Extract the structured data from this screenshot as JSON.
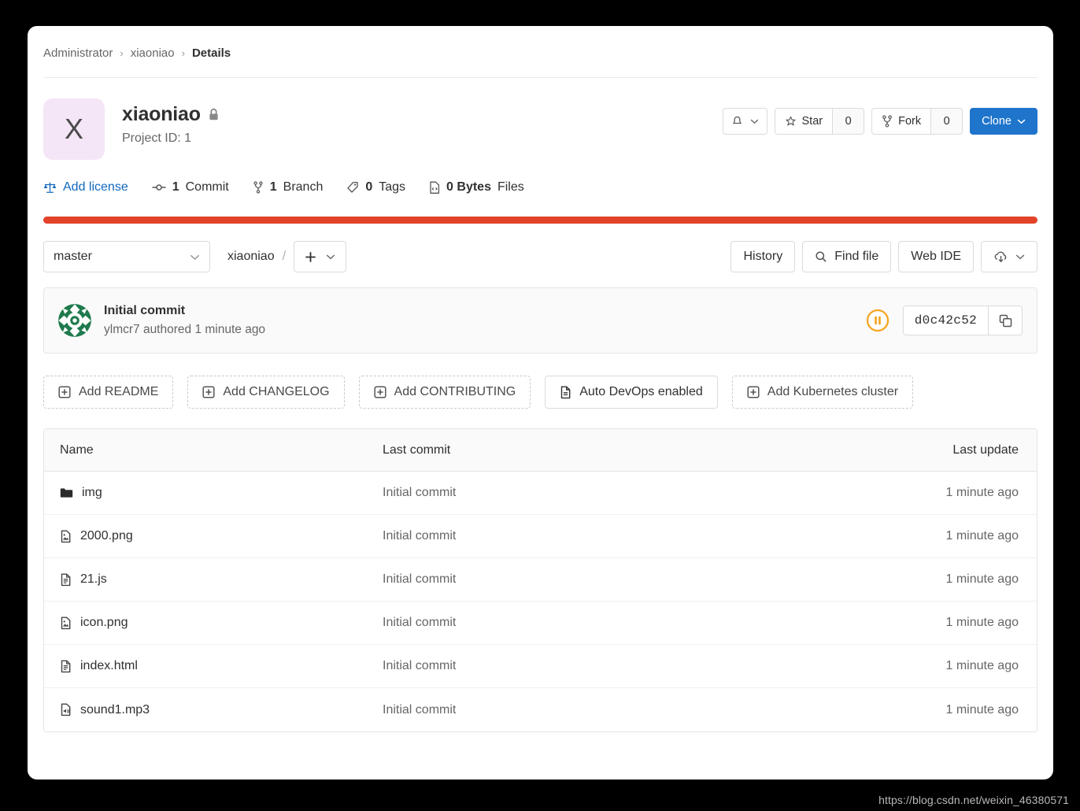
{
  "breadcrumb": {
    "items": [
      {
        "label": "Administrator",
        "current": false
      },
      {
        "label": "xiaoniao",
        "current": false
      },
      {
        "label": "Details",
        "current": true
      }
    ],
    "separator": "›"
  },
  "project": {
    "avatar_letter": "X",
    "avatar_bg": "#f4e6f6",
    "name": "xiaoniao",
    "visibility_icon": "lock-icon",
    "id_label": "Project ID: 1"
  },
  "header_actions": {
    "notifications_icon": "bell-icon",
    "notifications_chevron": "chevron-down-icon",
    "star_label": "Star",
    "star_count": "0",
    "star_icon": "star-icon",
    "fork_label": "Fork",
    "fork_count": "0",
    "fork_icon": "fork-icon",
    "clone_label": "Clone",
    "clone_chevron": "chevron-down-icon",
    "clone_color": "#1f75cb"
  },
  "stats": [
    {
      "icon": "scale-icon",
      "value": "",
      "label": "Add license",
      "link": true
    },
    {
      "icon": "commit-icon",
      "value": "1",
      "label": "Commit",
      "link": false
    },
    {
      "icon": "branch-icon",
      "value": "1",
      "label": "Branch",
      "link": false
    },
    {
      "icon": "tag-icon",
      "value": "0",
      "label": "Tags",
      "link": false
    },
    {
      "icon": "file-code-icon",
      "value": "0 Bytes",
      "label": "Files",
      "link": false
    }
  ],
  "language_bar": {
    "color": "#e24329"
  },
  "toolbar": {
    "branch": "master",
    "branch_chevron": "chevron-down-icon",
    "path_name": "xiaoniao",
    "path_separator": "/",
    "add_icon": "plus-icon",
    "add_chevron": "chevron-down-icon",
    "history_label": "History",
    "find_file_label": "Find file",
    "find_file_icon": "search-icon",
    "web_ide_label": "Web IDE",
    "download_icon": "download-cloud-icon",
    "download_chevron": "chevron-down-icon"
  },
  "commit": {
    "avatar": "identicon-green",
    "title": "Initial commit",
    "subtitle": "ylmcr7 authored 1 minute ago",
    "pipeline_status_icon": "pipeline-pending-icon",
    "pipeline_status_color": "#f5a623",
    "sha": "d0c42c52",
    "copy_icon": "copy-icon"
  },
  "add_file_buttons": [
    {
      "icon": "plus-square-icon",
      "label": "Add README",
      "dashed": true
    },
    {
      "icon": "plus-square-icon",
      "label": "Add CHANGELOG",
      "dashed": true
    },
    {
      "icon": "plus-square-icon",
      "label": "Add CONTRIBUTING",
      "dashed": true
    },
    {
      "icon": "doc-icon",
      "label": "Auto DevOps enabled",
      "dashed": false
    },
    {
      "icon": "plus-square-icon",
      "label": "Add Kubernetes cluster",
      "dashed": true
    }
  ],
  "file_table": {
    "columns": {
      "name": "Name",
      "last_commit": "Last commit",
      "last_update": "Last update"
    },
    "rows": [
      {
        "icon": "folder-icon",
        "name": "img",
        "last_commit": "Initial commit",
        "last_update": "1 minute ago"
      },
      {
        "icon": "image-file-icon",
        "name": "2000.png",
        "last_commit": "Initial commit",
        "last_update": "1 minute ago"
      },
      {
        "icon": "text-file-icon",
        "name": "21.js",
        "last_commit": "Initial commit",
        "last_update": "1 minute ago"
      },
      {
        "icon": "image-file-icon",
        "name": "icon.png",
        "last_commit": "Initial commit",
        "last_update": "1 minute ago"
      },
      {
        "icon": "text-file-icon",
        "name": "index.html",
        "last_commit": "Initial commit",
        "last_update": "1 minute ago"
      },
      {
        "icon": "audio-file-icon",
        "name": "sound1.mp3",
        "last_commit": "Initial commit",
        "last_update": "1 minute ago"
      }
    ]
  },
  "watermark": "https://blog.csdn.net/weixin_46380571"
}
